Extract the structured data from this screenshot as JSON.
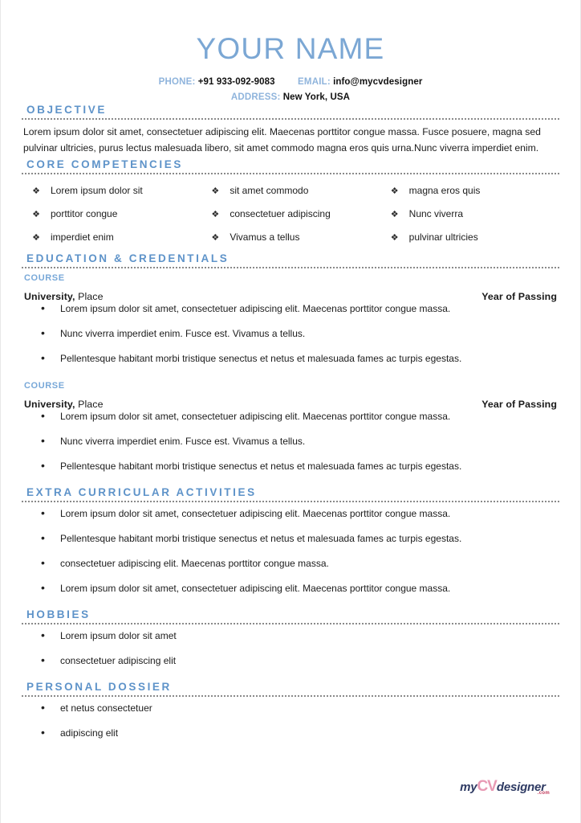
{
  "header": {
    "name": "YOUR NAME",
    "phone_label": "PHONE:",
    "phone_value": "+91 933-092-9083",
    "email_label": "EMAIL:",
    "email_value": "info@mycvdesigner",
    "address_label": "ADDRESS:",
    "address_value": "New York, USA"
  },
  "colors": {
    "heading_blue": "#5E93C9",
    "name_blue": "#7BA7D4",
    "label_blue": "#8FB4DC",
    "course_blue": "#78A8D8",
    "body_text": "#1c1c1c",
    "divider": "#8a8a8a"
  },
  "sections": {
    "objective": {
      "title": "OBJECTIVE",
      "body": "Lorem ipsum dolor sit amet, consectetuer adipiscing elit. Maecenas porttitor congue massa. Fusce posuere, magna sed pulvinar ultricies, purus lectus malesuada libero, sit amet commodo magna eros quis urna.Nunc viverra imperdiet enim."
    },
    "core_competencies": {
      "title": "CORE COMPETENCIES",
      "bullet_glyph": "❖",
      "items": [
        "Lorem ipsum dolor sit",
        "sit amet commodo",
        "magna eros quis",
        "porttitor congue",
        "consectetuer adipiscing",
        "Nunc viverra",
        "imperdiet enim",
        "Vivamus a tellus",
        "pulvinar ultricies"
      ]
    },
    "education": {
      "title": "EDUCATION & CREDENTIALS",
      "entries": [
        {
          "course_label": "COURSE",
          "university": "University,",
          "place": " Place",
          "year": "Year of Passing",
          "bullets": [
            "Lorem ipsum dolor sit amet, consectetuer adipiscing elit. Maecenas porttitor congue massa.",
            "Nunc viverra imperdiet enim. Fusce est. Vivamus a tellus.",
            "Pellentesque habitant morbi tristique senectus et netus et malesuada fames ac turpis egestas."
          ]
        },
        {
          "course_label": "COURSE",
          "university": "University,",
          "place": " Place",
          "year": "Year of Passing",
          "bullets": [
            "Lorem ipsum dolor sit amet, consectetuer adipiscing elit. Maecenas porttitor congue massa.",
            "Nunc viverra imperdiet enim. Fusce est. Vivamus a tellus.",
            "Pellentesque habitant morbi tristique senectus et netus et malesuada fames ac turpis egestas."
          ]
        }
      ]
    },
    "extra_curricular": {
      "title": "EXTRA CURRICULAR ACTIVITIES",
      "bullets": [
        "Lorem ipsum dolor sit amet, consectetuer adipiscing elit. Maecenas porttitor congue massa.",
        "Pellentesque habitant morbi tristique senectus et netus et malesuada fames ac turpis egestas.",
        "consectetuer adipiscing elit. Maecenas porttitor congue massa.",
        "Lorem ipsum dolor sit amet, consectetuer adipiscing elit. Maecenas porttitor congue massa."
      ]
    },
    "hobbies": {
      "title": "HOBBIES",
      "bullets": [
        "Lorem ipsum dolor sit amet",
        "consectetuer adipiscing elit"
      ]
    },
    "personal_dossier": {
      "title": "PERSONAL DOSSIER",
      "bullets": [
        "et netus consectetuer",
        "adipiscing elit"
      ]
    }
  },
  "footer": {
    "logo_my": "my",
    "logo_cv": "CV",
    "logo_designer": "designer",
    "logo_dotcom": ".com"
  }
}
